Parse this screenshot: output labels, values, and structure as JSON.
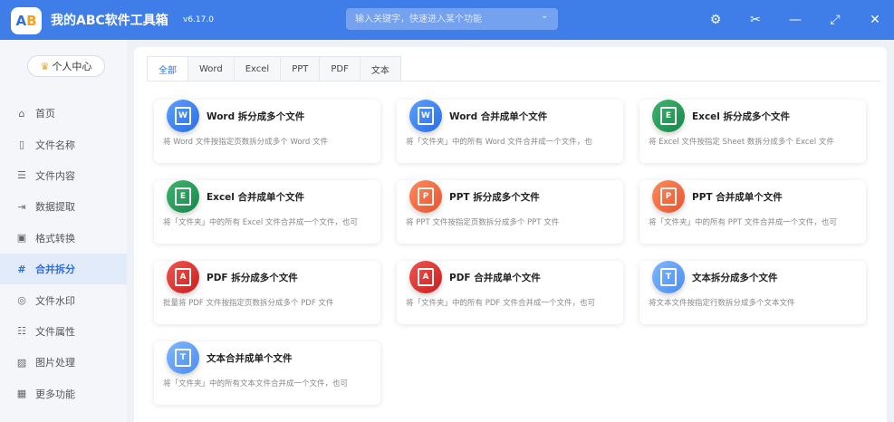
{
  "app": {
    "logo_a": "A",
    "logo_b": "B",
    "title": "我的ABC软件工具箱",
    "version": "v6.17.0",
    "search_placeholder": "输入关键字，快速进入某个功能",
    "icons": [
      "gear-icon",
      "scissors-icon",
      "minimize-icon",
      "maximize-icon",
      "close-icon"
    ]
  },
  "sidebar": {
    "user_center": "个人中心",
    "items": [
      {
        "label": "首页",
        "icon": "⌂"
      },
      {
        "label": "文件名称",
        "icon": "▯"
      },
      {
        "label": "文件内容",
        "icon": "☰"
      },
      {
        "label": "数据提取",
        "icon": "⇥"
      },
      {
        "label": "格式转换",
        "icon": "▣"
      },
      {
        "label": "合并拆分",
        "icon": "#",
        "active": true
      },
      {
        "label": "文件水印",
        "icon": "◎"
      },
      {
        "label": "文件属性",
        "icon": "☷"
      },
      {
        "label": "图片处理",
        "icon": "▨"
      },
      {
        "label": "更多功能",
        "icon": "▦"
      }
    ]
  },
  "tabs": [
    "全部",
    "Word",
    "Excel",
    "PPT",
    "PDF",
    "文本"
  ],
  "cards": [
    {
      "title": "Word 拆分成多个文件",
      "desc": "将 Word 文件按指定页数拆分成多个 Word 文件",
      "color": "blue",
      "glyph": "W"
    },
    {
      "title": "Word 合并成单个文件",
      "desc": "将「文件夹」中的所有 Word 文件合并成一个文件，也",
      "color": "blue",
      "glyph": "W"
    },
    {
      "title": "Excel 拆分成多个文件",
      "desc": "将 Excel 文件按指定 Sheet 数拆分成多个 Excel 文件",
      "color": "green",
      "glyph": "E"
    },
    {
      "title": "Excel 合并成单个文件",
      "desc": "将「文件夹」中的所有 Excel 文件合并成一个文件，也可",
      "color": "green",
      "glyph": "E"
    },
    {
      "title": "PPT 拆分成多个文件",
      "desc": "将 PPT 文件按指定页数拆分成多个 PPT 文件",
      "color": "orange",
      "glyph": "P"
    },
    {
      "title": "PPT 合并成单个文件",
      "desc": "将「文件夹」中的所有 PPT 文件合并成一个文件，也可",
      "color": "orange",
      "glyph": "P"
    },
    {
      "title": "PDF 拆分成多个文件",
      "desc": "批量将 PDF 文件按指定页数拆分成多个 PDF 文件",
      "color": "red",
      "glyph": "A"
    },
    {
      "title": "PDF 合并成单个文件",
      "desc": "将「文件夹」中的所有 PDF 文件合并成一个文件，也可",
      "color": "red",
      "glyph": "A"
    },
    {
      "title": "文本拆分成多个文件",
      "desc": "将文本文件按指定行数拆分成多个文本文件",
      "color": "sky",
      "glyph": "T"
    },
    {
      "title": "文本合并成单个文件",
      "desc": "将「文件夹」中的所有文本文件合并成一个文件，也可",
      "color": "sky",
      "glyph": "T"
    }
  ]
}
